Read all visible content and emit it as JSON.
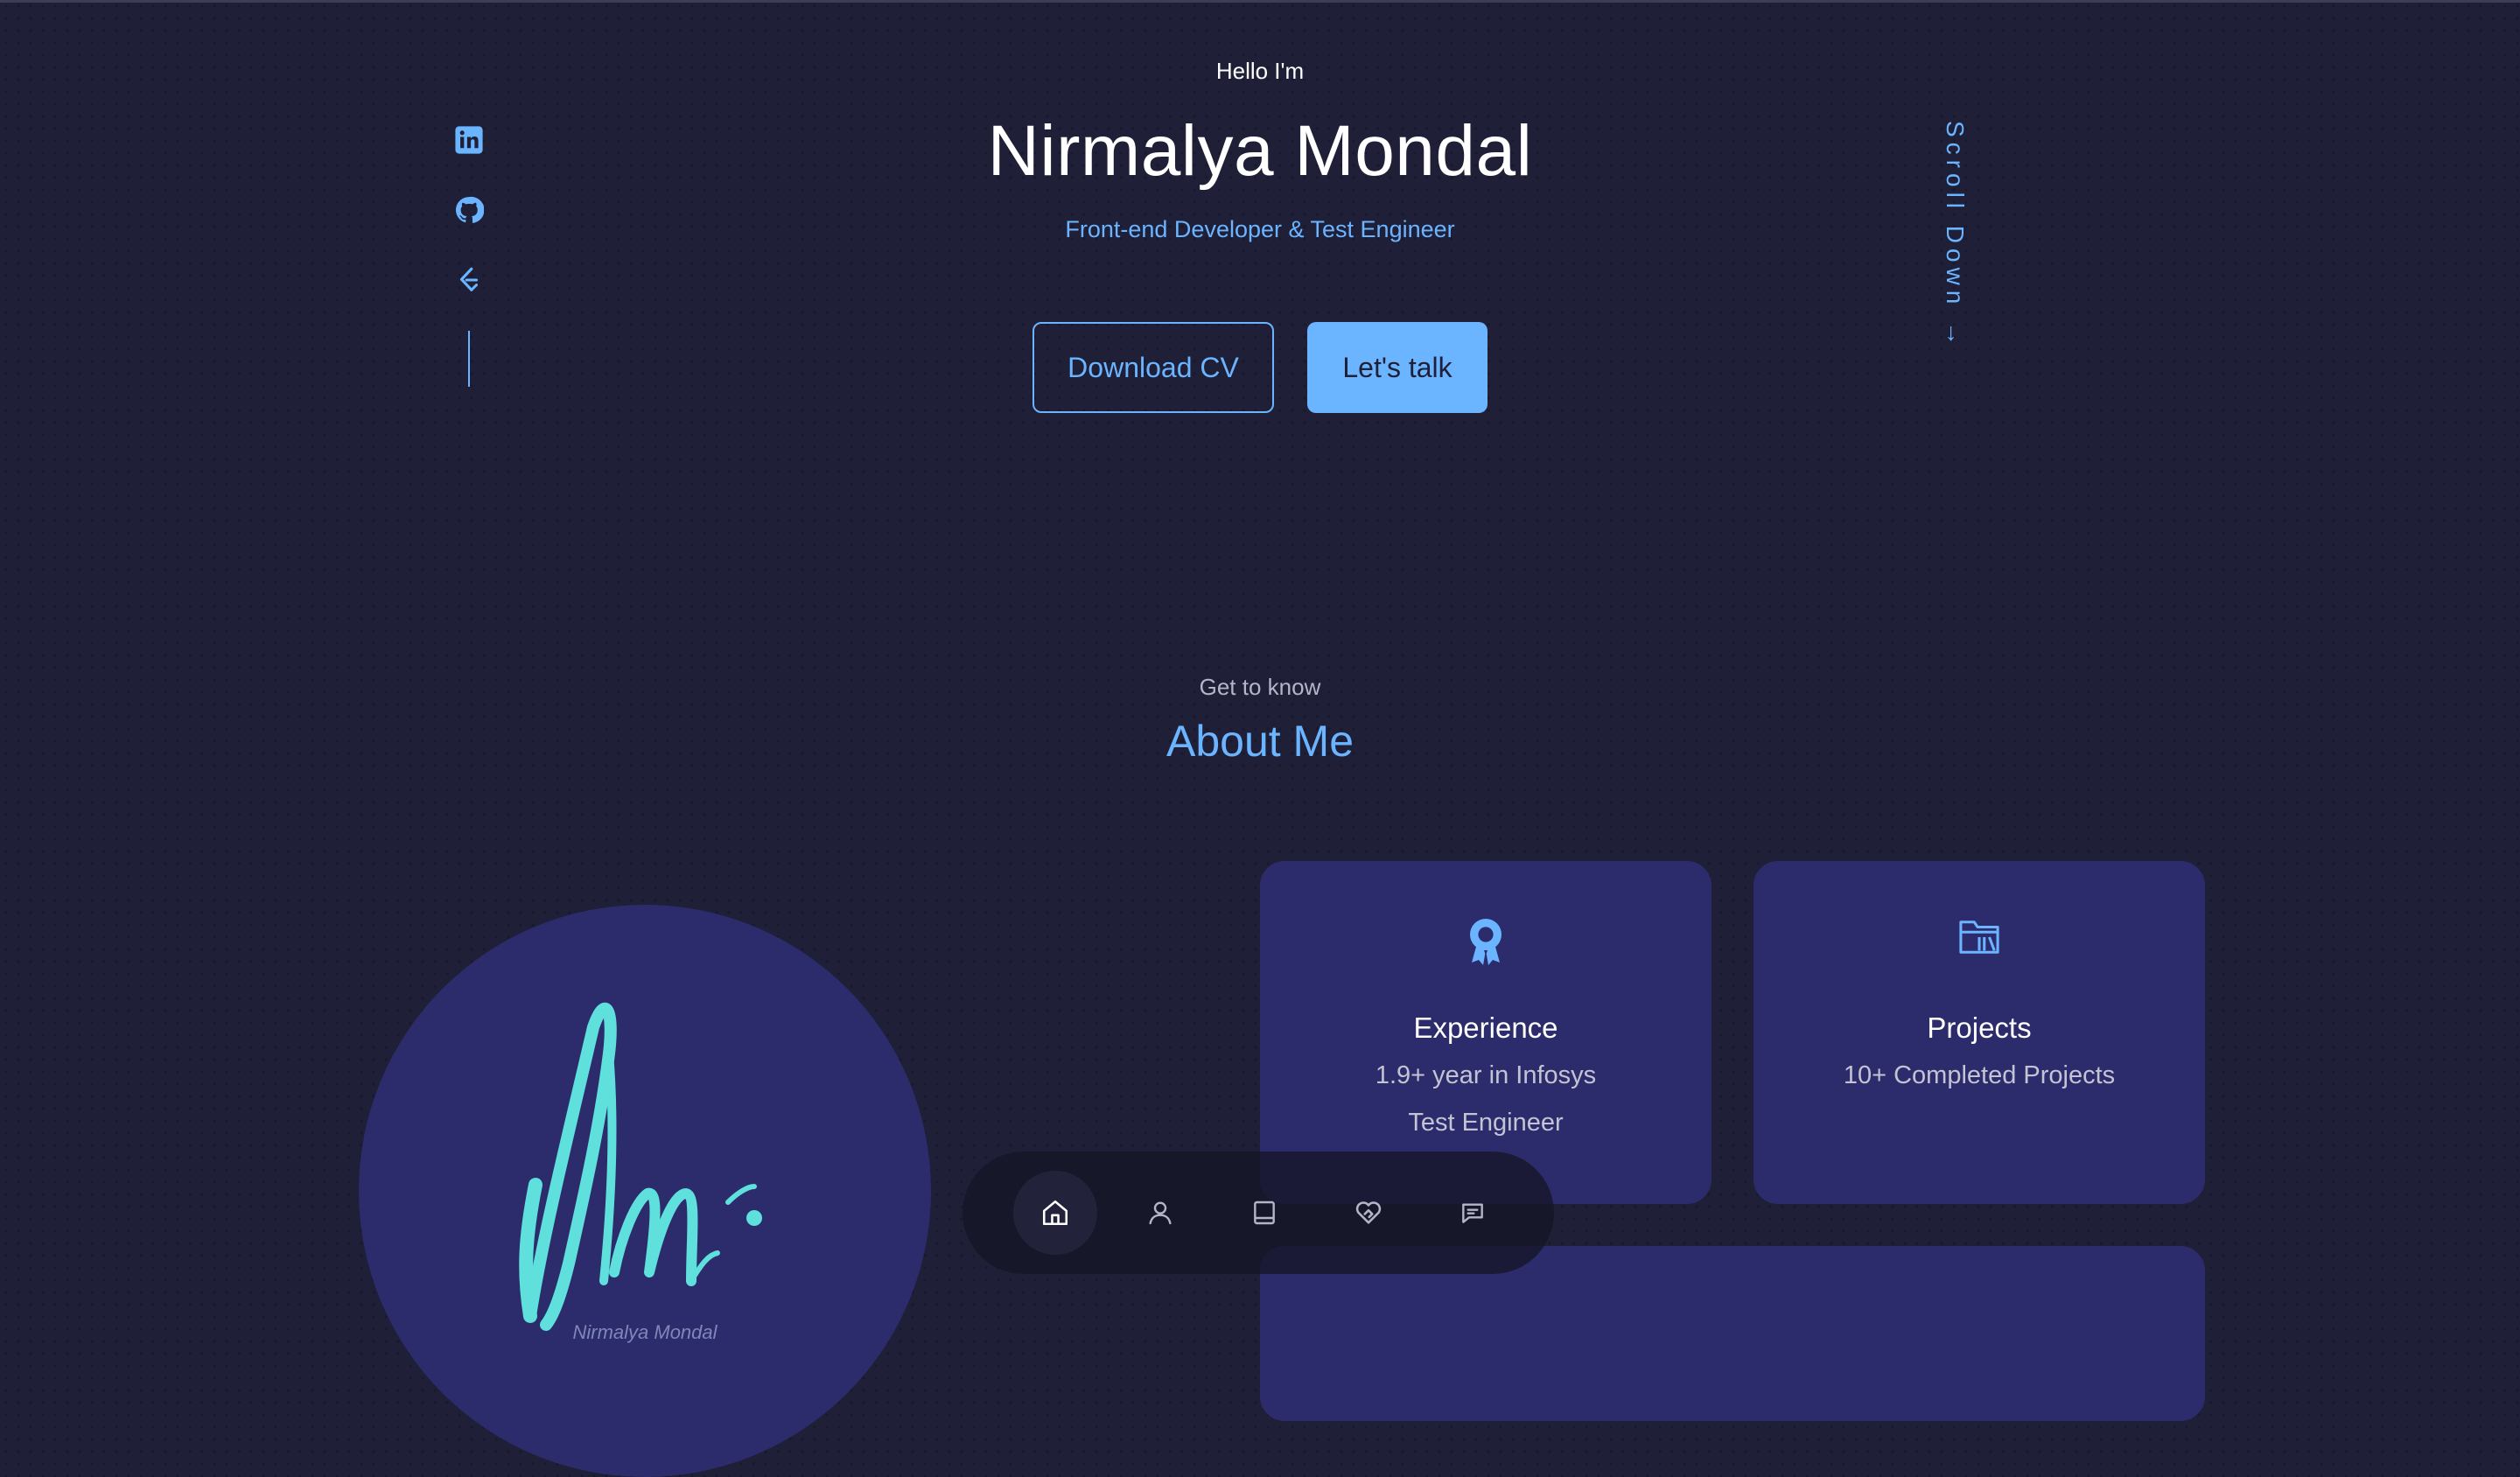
{
  "hero": {
    "greeting": "Hello I'm",
    "name": "Nirmalya Mondal",
    "role": "Front-end Developer & Test Engineer",
    "download_label": "Download CV",
    "talk_label": "Let's talk",
    "scroll_label": "Scroll Down →"
  },
  "social": [
    {
      "icon": "linkedin-icon"
    },
    {
      "icon": "github-icon"
    },
    {
      "icon": "leetcode-icon"
    }
  ],
  "about": {
    "kicker": "Get to know",
    "title": "About Me",
    "avatar_text": "Nm.",
    "avatar_caption": "Nirmalya Mondal",
    "cards": [
      {
        "icon": "award-icon",
        "title": "Experience",
        "line1": "1.9+ year in Infosys",
        "line2": "Test Engineer"
      },
      {
        "icon": "projects-icon",
        "title": "Projects",
        "line1": "10+ Completed Projects"
      }
    ]
  },
  "nav": [
    {
      "icon": "home-icon",
      "active": true
    },
    {
      "icon": "user-icon",
      "active": false
    },
    {
      "icon": "book-icon",
      "active": false
    },
    {
      "icon": "services-icon",
      "active": false
    },
    {
      "icon": "message-icon",
      "active": false
    }
  ],
  "colors": {
    "background": "#1f1f38",
    "accent": "#6bb4ff",
    "card": "#2c2c6c",
    "logo": "#5fe0dc"
  }
}
